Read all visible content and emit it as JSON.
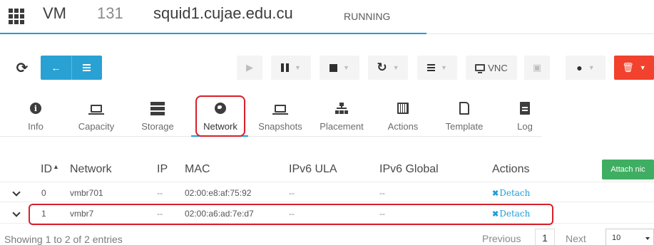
{
  "header": {
    "type_label": "VM",
    "id": "131",
    "name": "squid1.cujae.edu.cu",
    "state": "RUNNING"
  },
  "toolbar": {
    "vnc_label": "VNC"
  },
  "tabs": [
    {
      "label": "Info",
      "icon": "info-icon"
    },
    {
      "label": "Capacity",
      "icon": "laptop-icon"
    },
    {
      "label": "Storage",
      "icon": "storage-icon"
    },
    {
      "label": "Network",
      "icon": "globe-icon",
      "active": true
    },
    {
      "label": "Snapshots",
      "icon": "laptop-icon"
    },
    {
      "label": "Placement",
      "icon": "sitemap-icon"
    },
    {
      "label": "Actions",
      "icon": "calendar-icon"
    },
    {
      "label": "Template",
      "icon": "file-icon"
    },
    {
      "label": "Log",
      "icon": "log-icon"
    }
  ],
  "table": {
    "columns": [
      "ID",
      "Network",
      "IP",
      "MAC",
      "IPv6 ULA",
      "IPv6 Global",
      "Actions"
    ],
    "attach_label": "Attach nic",
    "rows": [
      {
        "id": "0",
        "network": "vmbr701",
        "ip": "--",
        "mac": "02:00:e8:af:75:92",
        "ipv6_ula": "--",
        "ipv6_global": "--",
        "action": "Detach"
      },
      {
        "id": "1",
        "network": "vmbr7",
        "ip": "--",
        "mac": "02:00:a6:ad:7e:d7",
        "ipv6_ula": "--",
        "ipv6_global": "--",
        "action": "Detach"
      }
    ]
  },
  "footer": {
    "showing": "Showing 1 to 2 of 2 entries",
    "previous": "Previous",
    "page": "1",
    "next": "Next",
    "page_size": "10"
  },
  "colors": {
    "accent": "#1f9ed9",
    "danger": "#f2412c",
    "success": "#3fae62",
    "highlight": "#d8202a"
  }
}
